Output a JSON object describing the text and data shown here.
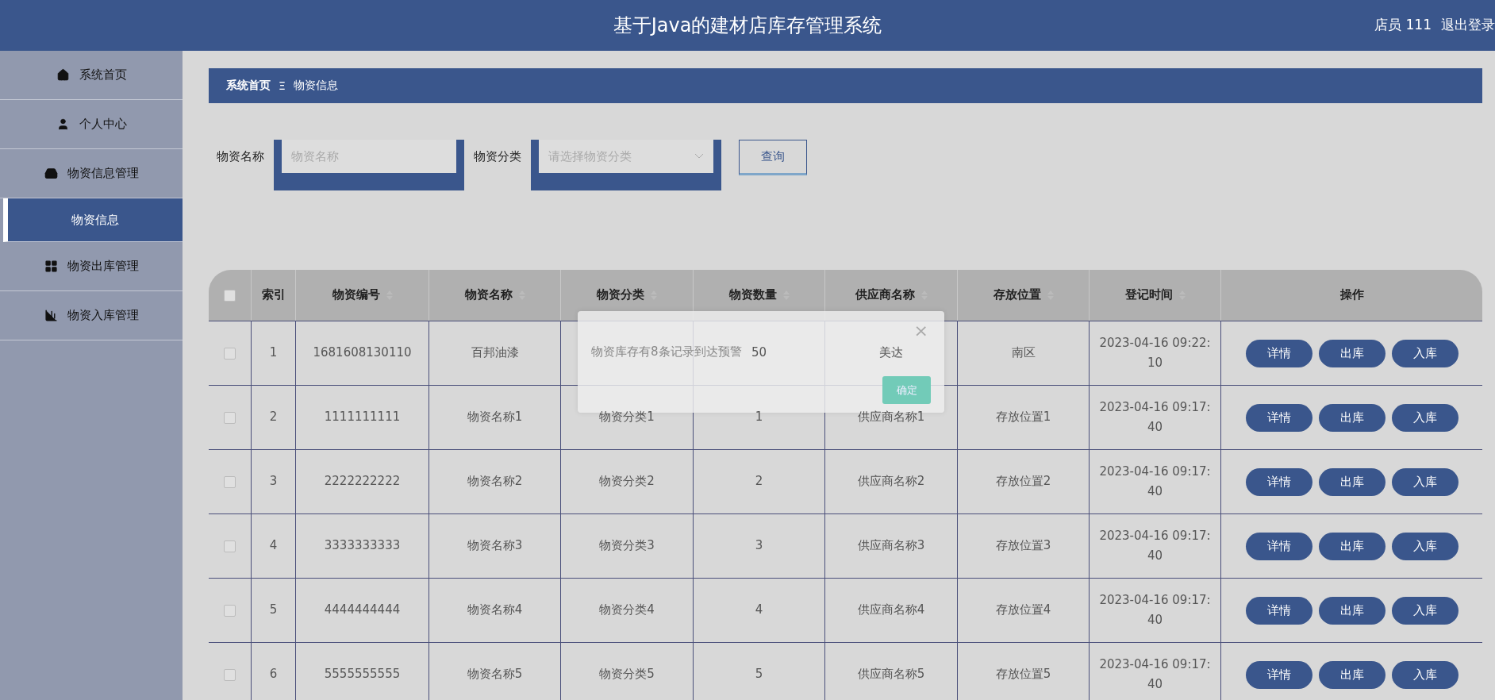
{
  "header": {
    "title": "基于Java的建材店库存管理系统",
    "user": "店员 111",
    "logout": "退出登录"
  },
  "sidebar": {
    "items": [
      {
        "label": "系统首页",
        "selected": false
      },
      {
        "label": "个人中心",
        "selected": false
      },
      {
        "label": "物资信息管理",
        "selected": false
      },
      {
        "label": "物资信息",
        "selected": true
      },
      {
        "label": "物资出库管理",
        "selected": false
      },
      {
        "label": "物资入库管理",
        "selected": false
      }
    ]
  },
  "breadcrumb": {
    "items": [
      "系统首页",
      "物资信息"
    ],
    "separator": "Ξ"
  },
  "search": {
    "fields": [
      {
        "kind": "input",
        "label": "物资名称",
        "placeholder": "物资名称"
      },
      {
        "kind": "select",
        "label": "物资分类",
        "placeholder": "请选择物资分类"
      }
    ],
    "button": "查询"
  },
  "table": {
    "all_checked": false,
    "columns": [
      {
        "label": "索引",
        "sortable": false
      },
      {
        "label": "物资编号",
        "sortable": true
      },
      {
        "label": "物资名称",
        "sortable": true
      },
      {
        "label": "物资分类",
        "sortable": true
      },
      {
        "label": "物资数量",
        "sortable": true
      },
      {
        "label": "供应商名称",
        "sortable": true
      },
      {
        "label": "存放位置",
        "sortable": true
      },
      {
        "label": "登记时间",
        "sortable": true
      },
      {
        "label": "操作",
        "sortable": false
      }
    ],
    "rows": [
      {
        "checked": false,
        "cells": [
          "1",
          "1681608130110",
          "百邦油漆",
          null,
          "50",
          "美达",
          "南区",
          "2023-04-16 09:22:10"
        ],
        "actions": [
          "详情",
          "出库",
          "入库"
        ]
      },
      {
        "checked": false,
        "cells": [
          "2",
          "1111111111",
          "物资名称1",
          "物资分类1",
          "1",
          "供应商名称1",
          "存放位置1",
          "2023-04-16 09:17:40"
        ],
        "actions": [
          "详情",
          "出库",
          "入库"
        ]
      },
      {
        "checked": false,
        "cells": [
          "3",
          "2222222222",
          "物资名称2",
          "物资分类2",
          "2",
          "供应商名称2",
          "存放位置2",
          "2023-04-16 09:17:40"
        ],
        "actions": [
          "详情",
          "出库",
          "入库"
        ]
      },
      {
        "checked": false,
        "cells": [
          "4",
          "3333333333",
          "物资名称3",
          "物资分类3",
          "3",
          "供应商名称3",
          "存放位置3",
          "2023-04-16 09:17:40"
        ],
        "actions": [
          "详情",
          "出库",
          "入库"
        ]
      },
      {
        "checked": false,
        "cells": [
          "5",
          "4444444444",
          "物资名称4",
          "物资分类4",
          "4",
          "供应商名称4",
          "存放位置4",
          "2023-04-16 09:17:40"
        ],
        "actions": [
          "详情",
          "出库",
          "入库"
        ]
      },
      {
        "checked": false,
        "cells": [
          "6",
          "5555555555",
          "物资名称5",
          "物资分类5",
          "5",
          "供应商名称5",
          "存放位置5",
          "2023-04-16 09:17:40"
        ],
        "actions": [
          "详情",
          "出库",
          "入库"
        ]
      }
    ]
  },
  "dialog": {
    "message": "物资库存有8条记录到达预警",
    "close": "×",
    "button": "确定"
  }
}
